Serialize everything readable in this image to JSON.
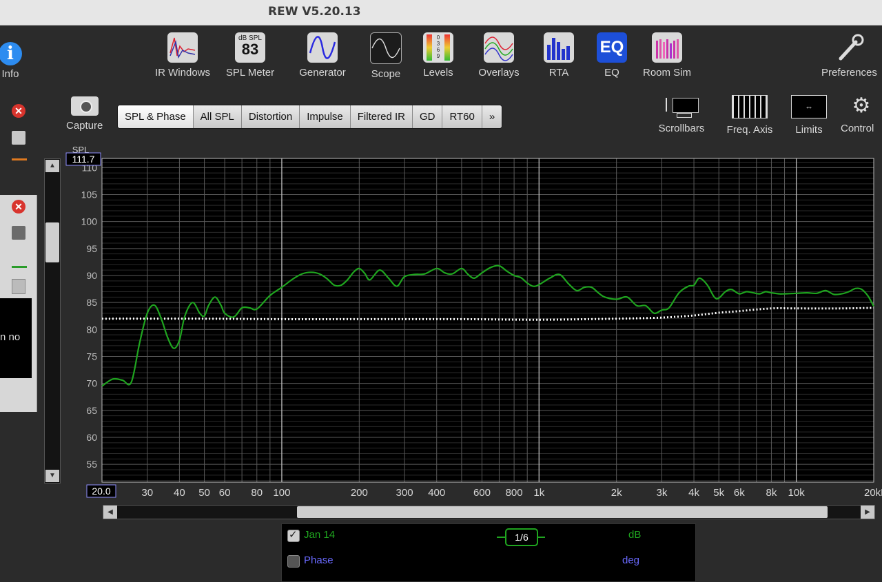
{
  "window": {
    "title": "REW V5.20.13"
  },
  "toolbar": {
    "info": "Info",
    "items": [
      "IR Windows",
      "SPL Meter",
      "Generator",
      "Scope",
      "Levels",
      "Overlays",
      "RTA",
      "EQ",
      "Room Sim"
    ],
    "spl_meter_unit": "dB SPL",
    "spl_meter_value": "83",
    "eq_icon_text": "EQ",
    "levels_icon_digits": "0\n3\n6\n9",
    "preferences": "Preferences"
  },
  "left_panel": {
    "text_fragment": "n no"
  },
  "capture": {
    "label": "Capture"
  },
  "tabs": [
    "SPL & Phase",
    "All SPL",
    "Distortion",
    "Impulse",
    "Filtered IR",
    "GD",
    "RT60",
    "»"
  ],
  "right_tools": [
    "Scrollbars",
    "Freq. Axis",
    "Limits",
    "Control"
  ],
  "graph": {
    "y_axis_title": "SPL",
    "y_top_value": "111.7",
    "x_left_value": "20.0",
    "colors": {
      "measurement": "#1fa51f",
      "dotted": "#ffffff",
      "grid": "#555555",
      "bg": "#000000"
    }
  },
  "legend": {
    "rows": [
      {
        "name": "Jan 14",
        "smoothing": "1/6",
        "unit": "dB",
        "checked": true,
        "color": "#1fa51f"
      },
      {
        "name": "Phase",
        "smoothing": "",
        "unit": "deg",
        "checked": false,
        "color": "#6a6aff"
      }
    ]
  },
  "chart_data": {
    "type": "line",
    "xlabel": "",
    "ylabel": "SPL",
    "x_scale": "log",
    "xlim": [
      20,
      20000
    ],
    "ylim": [
      51.7,
      111.7
    ],
    "y_ticks": [
      110,
      105,
      100,
      95,
      90,
      85,
      80,
      75,
      70,
      65,
      60,
      55
    ],
    "x_ticks": [
      {
        "v": 30,
        "label": "30"
      },
      {
        "v": 40,
        "label": "40"
      },
      {
        "v": 50,
        "label": "50"
      },
      {
        "v": 60,
        "label": "60"
      },
      {
        "v": 80,
        "label": "80"
      },
      {
        "v": 100,
        "label": "100"
      },
      {
        "v": 200,
        "label": "200"
      },
      {
        "v": 300,
        "label": "300"
      },
      {
        "v": 400,
        "label": "400"
      },
      {
        "v": 600,
        "label": "600"
      },
      {
        "v": 800,
        "label": "800"
      },
      {
        "v": 1000,
        "label": "1k"
      },
      {
        "v": 2000,
        "label": "2k"
      },
      {
        "v": 3000,
        "label": "3k"
      },
      {
        "v": 4000,
        "label": "4k"
      },
      {
        "v": 5000,
        "label": "5k"
      },
      {
        "v": 6000,
        "label": "6k"
      },
      {
        "v": 8000,
        "label": "8k"
      },
      {
        "v": 10000,
        "label": "10k"
      },
      {
        "v": 20000,
        "label": "20kHz"
      }
    ],
    "grid": true,
    "series": [
      {
        "name": "Jan 14",
        "style": "solid",
        "x": [
          20,
          22,
          24,
          26,
          28,
          30,
          32,
          34,
          36,
          38,
          40,
          42,
          45,
          48,
          50,
          52,
          55,
          58,
          60,
          65,
          70,
          75,
          80,
          90,
          100,
          110,
          120,
          130,
          140,
          150,
          160,
          170,
          180,
          190,
          200,
          210,
          220,
          240,
          260,
          280,
          300,
          330,
          360,
          400,
          430,
          460,
          500,
          530,
          560,
          600,
          650,
          700,
          750,
          800,
          850,
          900,
          950,
          1000,
          1100,
          1200,
          1300,
          1400,
          1500,
          1600,
          1700,
          1800,
          2000,
          2200,
          2400,
          2600,
          2800,
          3000,
          3200,
          3500,
          3800,
          4000,
          4200,
          4500,
          4800,
          5000,
          5300,
          5600,
          6000,
          6400,
          6800,
          7200,
          7600,
          8000,
          8600,
          9000,
          10000,
          11000,
          12000,
          13000,
          14000,
          15000,
          16000,
          17000,
          18000,
          19000,
          20000
        ],
        "y": [
          69.5,
          70.8,
          70.6,
          70.2,
          77.5,
          83.0,
          84.5,
          82.0,
          78.5,
          76.5,
          78.0,
          82.5,
          85.0,
          83.0,
          82.5,
          84.5,
          86.0,
          84.5,
          83.0,
          82.3,
          84.0,
          84.0,
          83.8,
          86.3,
          87.8,
          89.3,
          90.3,
          90.6,
          90.3,
          89.4,
          88.2,
          88.2,
          89.2,
          90.6,
          91.3,
          90.4,
          89.2,
          91.0,
          89.5,
          88.0,
          89.8,
          90.2,
          90.3,
          91.3,
          90.5,
          90.3,
          91.3,
          90.2,
          89.5,
          90.5,
          91.5,
          91.8,
          90.8,
          90.0,
          89.6,
          88.6,
          88.0,
          88.3,
          89.5,
          90.2,
          88.5,
          87.2,
          87.8,
          87.8,
          86.8,
          86.0,
          85.6,
          86.0,
          84.4,
          84.4,
          83.0,
          83.6,
          84.0,
          86.8,
          88.0,
          88.2,
          89.5,
          88.3,
          86.0,
          85.8,
          87.0,
          87.4,
          86.6,
          87.0,
          86.8,
          86.6,
          87.0,
          86.8,
          86.6,
          86.6,
          86.7,
          86.8,
          86.7,
          87.2,
          86.5,
          86.6,
          87.0,
          87.6,
          87.4,
          86.2,
          84.3
        ]
      },
      {
        "name": "",
        "style": "dotted",
        "x": [
          20,
          50,
          100,
          200,
          500,
          1000,
          2000,
          3000,
          4000,
          5000,
          6000,
          8000,
          10000,
          15000,
          20000
        ],
        "y": [
          82.0,
          82.0,
          81.9,
          81.9,
          81.9,
          81.8,
          82.0,
          82.2,
          82.6,
          83.1,
          83.4,
          83.9,
          83.9,
          83.9,
          84.0
        ]
      }
    ]
  }
}
